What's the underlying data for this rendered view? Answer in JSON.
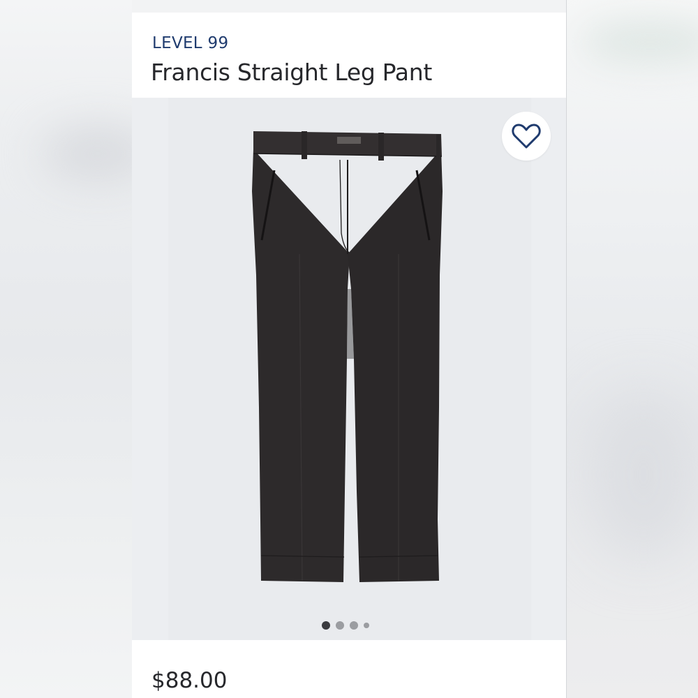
{
  "product": {
    "brand": "LEVEL 99",
    "name": "Francis Straight Leg Pant",
    "price": "$88.00"
  },
  "gallery": {
    "image_count": 4,
    "active_index": 0
  },
  "favorite": {
    "icon": "heart-outline-icon",
    "active": false
  },
  "colors": {
    "brand_text": "#1f3b6e",
    "primary_text": "#26272b",
    "heart": "#1f3b6e",
    "active_dot": "#3a3b3f",
    "inactive_dot": "#9b9da1"
  }
}
